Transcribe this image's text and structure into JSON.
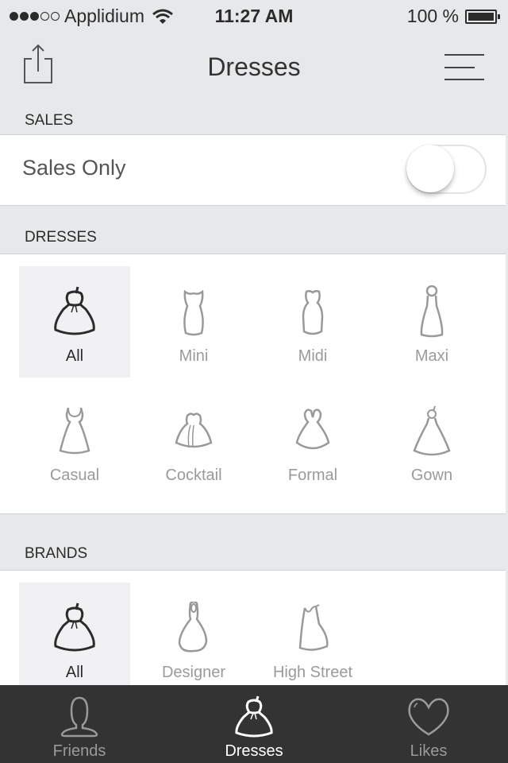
{
  "status_bar": {
    "signal_filled": 3,
    "signal_total": 5,
    "carrier": "Applidium",
    "time": "11:27 AM",
    "battery": "100 %"
  },
  "nav": {
    "title": "Dresses",
    "left_icon": "share-icon",
    "right_icon": "menu-icon"
  },
  "sales": {
    "header": "SALES",
    "label": "Sales Only",
    "toggle_on": false
  },
  "dresses": {
    "header": "DRESSES",
    "items": [
      {
        "label": "All",
        "icon": "dress-all-icon",
        "selected": true
      },
      {
        "label": "Mini",
        "icon": "dress-mini-icon",
        "selected": false
      },
      {
        "label": "Midi",
        "icon": "dress-midi-icon",
        "selected": false
      },
      {
        "label": "Maxi",
        "icon": "dress-maxi-icon",
        "selected": false
      },
      {
        "label": "Casual",
        "icon": "dress-casual-icon",
        "selected": false
      },
      {
        "label": "Cocktail",
        "icon": "dress-cocktail-icon",
        "selected": false
      },
      {
        "label": "Formal",
        "icon": "dress-formal-icon",
        "selected": false
      },
      {
        "label": "Gown",
        "icon": "dress-gown-icon",
        "selected": false
      }
    ]
  },
  "brands": {
    "header": "BRANDS",
    "items": [
      {
        "label": "All",
        "icon": "dress-all-icon",
        "selected": true
      },
      {
        "label": "Designer",
        "icon": "dress-designer-icon",
        "selected": false
      },
      {
        "label": "High Street",
        "icon": "dress-high-street-icon",
        "selected": false
      }
    ]
  },
  "tab_bar": {
    "tabs": [
      {
        "label": "Friends",
        "icon": "person-icon",
        "active": false
      },
      {
        "label": "Dresses",
        "icon": "dress-icon",
        "active": true
      },
      {
        "label": "Likes",
        "icon": "heart-icon",
        "active": false
      }
    ]
  },
  "colors": {
    "background": "#e7e8ea",
    "panel": "#ffffff",
    "selected_tile": "#f1f1f3",
    "tab_bar": "#333333",
    "inactive_text": "#9a9a9a",
    "active_text": "#2b2b2b"
  }
}
